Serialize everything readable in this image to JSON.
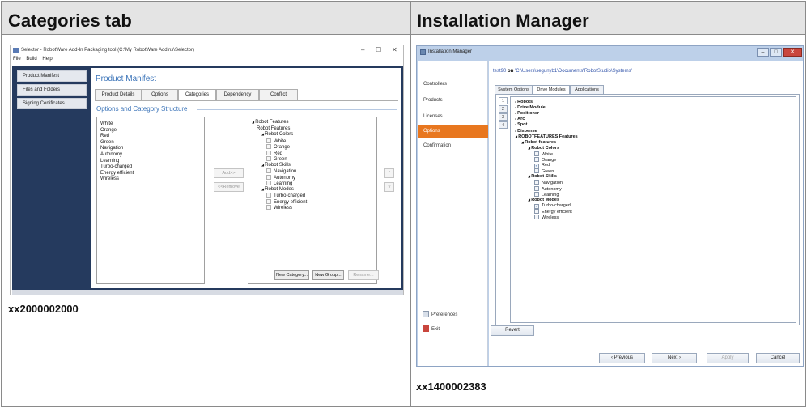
{
  "headers": {
    "left": "Categories tab",
    "right": "Installation Manager"
  },
  "codes": {
    "left": "xx2000002000",
    "right": "xx1400002383"
  },
  "selector": {
    "title": "Selector - RobotWare Add-In Packaging tool (C:\\My RobotWare Addins\\Selector)",
    "window_controls": [
      "–",
      "☐",
      "✕"
    ],
    "menu": [
      "File",
      "Build",
      "Help"
    ],
    "sidebar": [
      "Product Manifest",
      "Files and Folders",
      "Signing Certificates"
    ],
    "page_title": "Product Manifest",
    "tabs": [
      "Product Details",
      "Options",
      "Categories",
      "Dependency",
      "Conflict"
    ],
    "section_title": "Options and Category Structure",
    "options_list": [
      "White",
      "Orange",
      "Red",
      "Green",
      "Navigation",
      "Autonomy",
      "Learning",
      "Turbo-charged",
      "Energy efficient",
      "Wireless"
    ],
    "buttons": {
      "add": "Add>>",
      "remove": "<<Remove",
      "up": "^",
      "down": "v",
      "new_category": "New Category...",
      "new_group": "New Group...",
      "rename": "Rename..."
    },
    "tree": [
      {
        "label": "Robot Features",
        "level": 0,
        "arrow": true
      },
      {
        "label": "Robot Features",
        "level": 1,
        "arrow": false
      },
      {
        "label": "Robot Colors",
        "level": 2,
        "arrow": true
      },
      {
        "label": "White",
        "level": 3,
        "check": true
      },
      {
        "label": "Orange",
        "level": 3,
        "check": true
      },
      {
        "label": "Red",
        "level": 3,
        "check": true
      },
      {
        "label": "Green",
        "level": 3,
        "check": true
      },
      {
        "label": "Robot Skills",
        "level": 2,
        "arrow": true
      },
      {
        "label": "Navigation",
        "level": 3,
        "check": true
      },
      {
        "label": "Autonomy",
        "level": 3,
        "check": true
      },
      {
        "label": "Learning",
        "level": 3,
        "check": true
      },
      {
        "label": "Robot Modes",
        "level": 2,
        "arrow": true
      },
      {
        "label": "Turbo-charged",
        "level": 3,
        "check": true
      },
      {
        "label": "Energy efficient",
        "level": 3,
        "check": true
      },
      {
        "label": "Wireless",
        "level": 3,
        "check": true
      }
    ]
  },
  "installer": {
    "title": "Installation Manager",
    "sidebar": [
      "Controllers",
      "Products",
      "Licenses",
      "Options",
      "Confirmation"
    ],
    "active_item": "Options",
    "sidebar_footer": [
      "Preferences",
      "Exit"
    ],
    "path_system": "test90",
    "path_on": "on",
    "path": "'C:\\Users\\segunyb1\\Documents\\RobotStudio\\Systems'",
    "tabs": [
      "System Options",
      "Drive Modules",
      "Applications"
    ],
    "number_tabs": [
      "1",
      "2",
      "3",
      "4"
    ],
    "tree": [
      {
        "label": "Robots",
        "level": 0,
        "bold": true,
        "arrow": "▹"
      },
      {
        "label": "Drive Module",
        "level": 0,
        "bold": true,
        "arrow": "▹"
      },
      {
        "label": "Positioner",
        "level": 0,
        "bold": true,
        "arrow": "▹"
      },
      {
        "label": "Arc",
        "level": 0,
        "bold": true,
        "arrow": "▹"
      },
      {
        "label": "Spot",
        "level": 0,
        "bold": true,
        "arrow": "▹"
      },
      {
        "label": "Dispense",
        "level": 0,
        "bold": true,
        "arrow": "▹"
      },
      {
        "label": "ROBOTFEATURES Features",
        "level": 0,
        "bold": true,
        "arrow": "◢"
      },
      {
        "label": "Robot features",
        "level": 1,
        "bold": true,
        "arrow": "◢"
      },
      {
        "label": "Robot Colors",
        "level": 2,
        "bold": true,
        "arrow": "◢"
      },
      {
        "label": "White",
        "level": 3,
        "checked": false
      },
      {
        "label": "Orange",
        "level": 3,
        "checked": false
      },
      {
        "label": "Red",
        "level": 3,
        "checked": true
      },
      {
        "label": "Green",
        "level": 3,
        "checked": false
      },
      {
        "label": "Robot Skills",
        "level": 2,
        "bold": true,
        "arrow": "◢"
      },
      {
        "label": "Navigation",
        "level": 3,
        "checked": false
      },
      {
        "label": "Autonomy",
        "level": 3,
        "checked": false
      },
      {
        "label": "Learning",
        "level": 3,
        "checked": false
      },
      {
        "label": "Robot Modes",
        "level": 2,
        "bold": true,
        "arrow": "◢"
      },
      {
        "label": "Turbo-charged",
        "level": 3,
        "checked": true
      },
      {
        "label": "Energy efficient",
        "level": 3,
        "checked": false
      },
      {
        "label": "Wireless",
        "level": 3,
        "checked": false
      }
    ],
    "buttons": {
      "revert": "Revert",
      "previous": "Previous",
      "next": "Next",
      "apply": "Apply",
      "cancel": "Cancel"
    }
  },
  "colors": {
    "accent_orange": "#e8771f",
    "nav_dark": "#253a5e",
    "title_blue": "#3a73b8"
  }
}
